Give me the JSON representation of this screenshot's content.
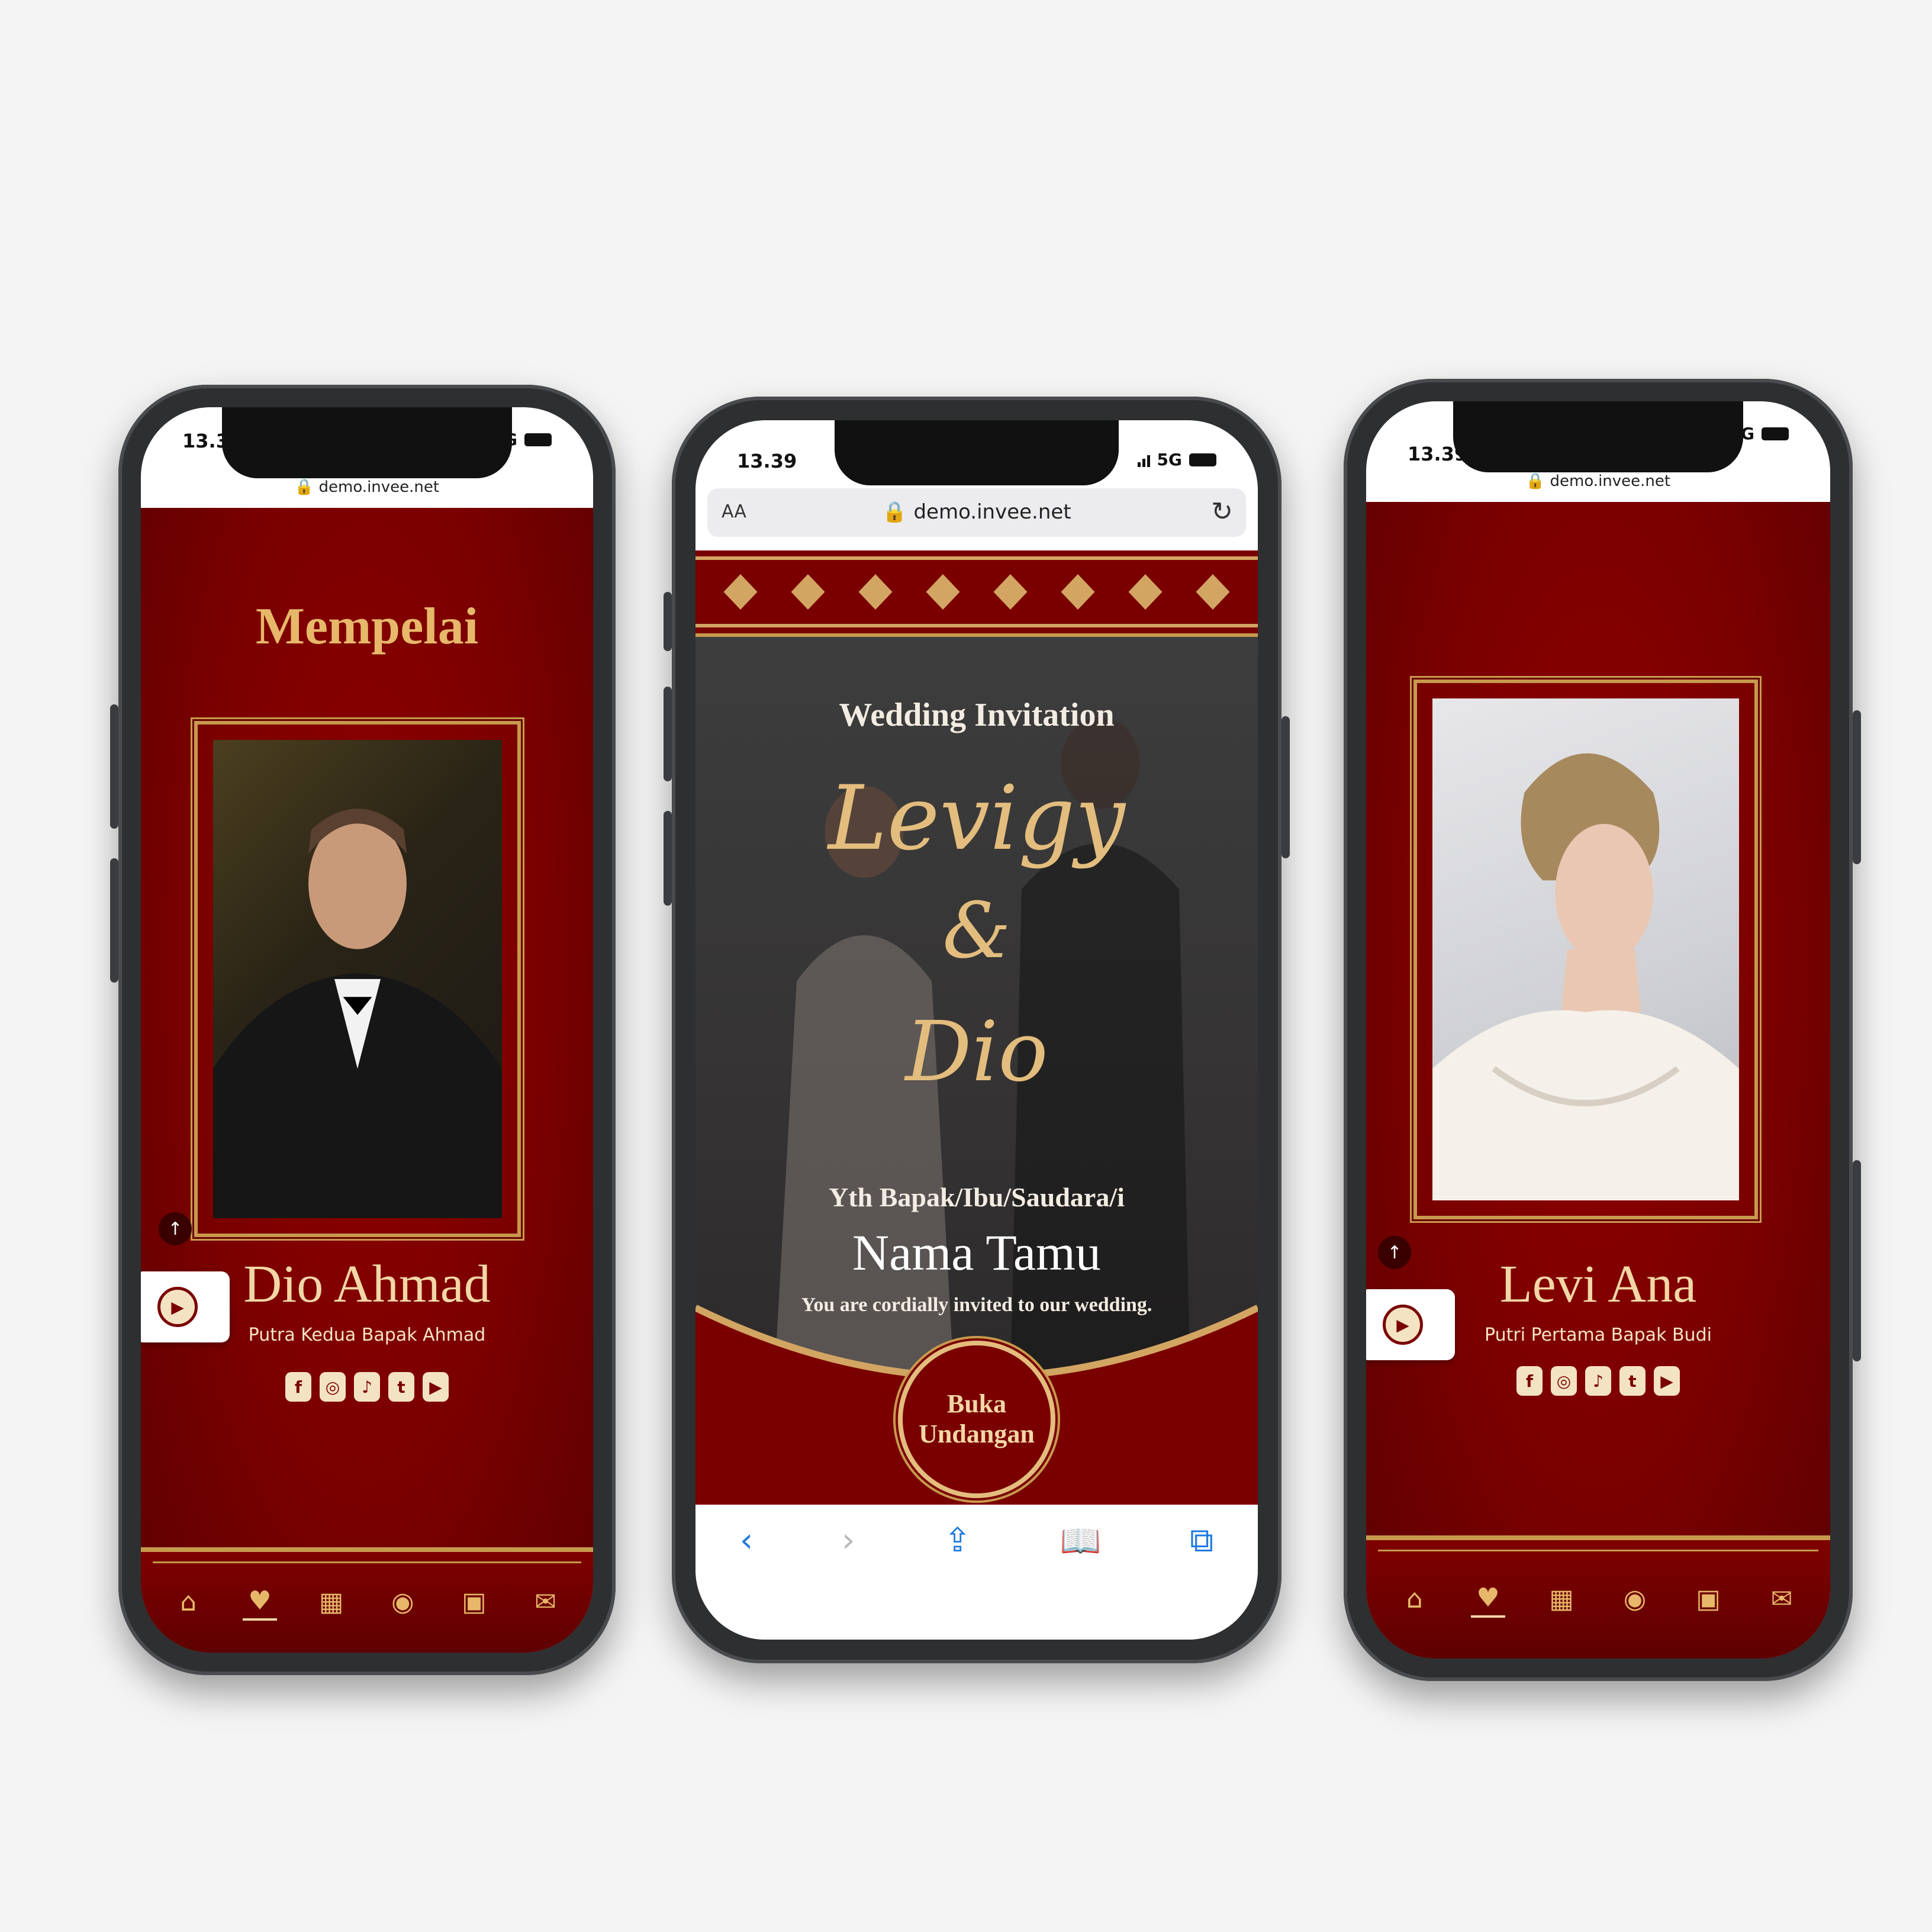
{
  "status": {
    "time": "13.39",
    "network": "5G"
  },
  "browser": {
    "aa": "AA",
    "url": "demo.invee.net",
    "reload_icon": "reload-icon"
  },
  "left": {
    "section_title": "Mempelai",
    "name": "Dio Ahmad",
    "subtitle": "Putra Kedua Bapak Ahmad"
  },
  "center": {
    "heading": "Wedding Invitation",
    "bride_script": "Levigy",
    "amp": "&",
    "groom_script": "Dio",
    "greeting": "Yth Bapak/Ibu/Saudara/i",
    "guest": "Nama Tamu",
    "invite_line": "You are cordially invited to our wedding.",
    "open_button_line1": "Buka",
    "open_button_line2": "Undangan"
  },
  "right": {
    "name": "Levi Ana",
    "subtitle": "Putri Pertama Bapak Budi"
  },
  "socials": [
    "f",
    "◎",
    "♪",
    "t",
    "▶"
  ],
  "nav_icons": [
    "arch-icon",
    "couple-icon",
    "calendar-icon",
    "camera-icon",
    "gallery-icon",
    "envelope-icon"
  ],
  "colors": {
    "maroon": "#7a0000",
    "gold": "#c79a4d",
    "cream": "#f2d7a6"
  }
}
